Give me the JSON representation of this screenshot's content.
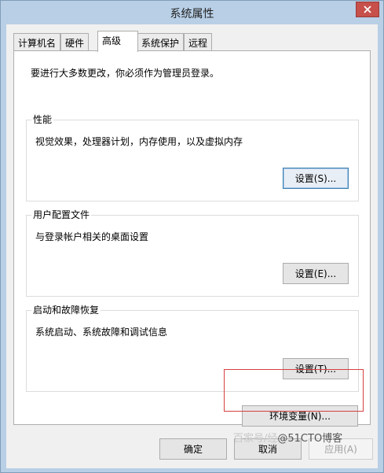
{
  "window": {
    "title": "系统属性"
  },
  "tabs": [
    {
      "label": "计算机名",
      "active": false
    },
    {
      "label": "硬件",
      "active": false
    },
    {
      "label": "高级",
      "active": true
    },
    {
      "label": "系统保护",
      "active": false
    },
    {
      "label": "远程",
      "active": false
    }
  ],
  "advanced": {
    "admin_notice": "要进行大多数更改，你必须作为管理员登录。",
    "performance": {
      "label": "性能",
      "description": "视觉效果，处理器计划，内存使用，以及虚拟内存",
      "button": "设置(S)..."
    },
    "user_profiles": {
      "label": "用户配置文件",
      "description": "与登录帐户相关的桌面设置",
      "button": "设置(E)..."
    },
    "startup_recovery": {
      "label": "启动和故障恢复",
      "description": "系统启动、系统故障和调试信息",
      "button": "设置(T)..."
    },
    "env_button": "环境变量(N)..."
  },
  "footer": {
    "ok": "确定",
    "cancel": "取消",
    "apply": "应用(A)"
  },
  "watermark": {
    "faded": "百家号/经",
    "main": "@51CTO博客"
  },
  "colors": {
    "titlebar": "#b8cfe6",
    "close_button": "#c7504b",
    "highlight_border": "#d64040"
  }
}
